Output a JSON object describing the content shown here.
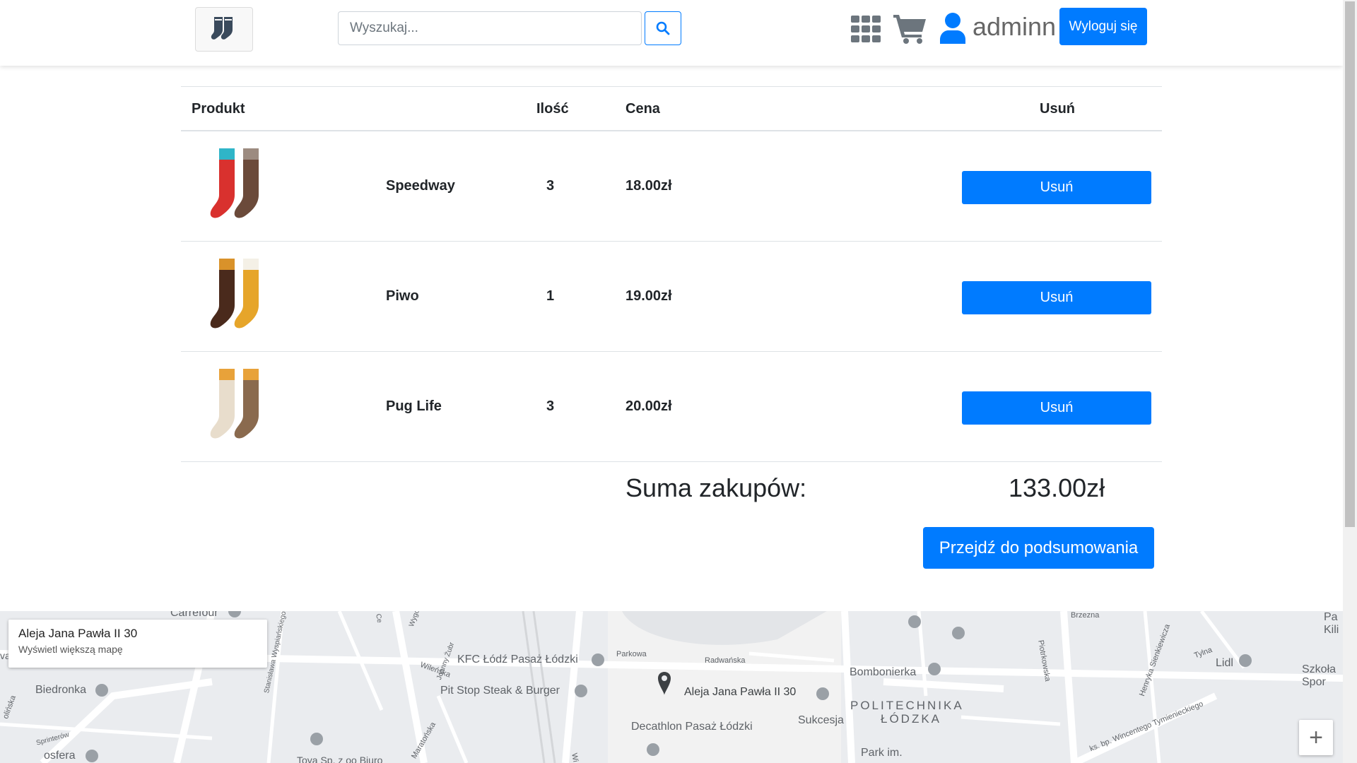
{
  "header": {
    "logo_icon": "socks-logo-icon",
    "search_placeholder": "Wyszukaj...",
    "search_icon": "search-icon",
    "grid_icon": "grid-icon",
    "cart_icon": "cart-icon",
    "user_icon": "user-icon",
    "username": "adminn",
    "logout_label": "Wyloguj się"
  },
  "cart": {
    "columns": {
      "product": "Produkt",
      "quantity": "Ilość",
      "price": "Cena",
      "remove": "Usuń"
    },
    "items": [
      {
        "name": "Speedway",
        "quantity": "3",
        "price": "18.00zł",
        "remove_label": "Usuń",
        "colors": {
          "left": "#d9312e",
          "right": "#6b4a3a",
          "cuff_left": "#2fb5c8",
          "cuff_right": "#9c8b80"
        }
      },
      {
        "name": "Piwo",
        "quantity": "1",
        "price": "19.00zł",
        "remove_label": "Usuń",
        "colors": {
          "left": "#4a2a1c",
          "right": "#e6a52a",
          "cuff_left": "#d9922a",
          "cuff_right": "#f4f0e6"
        }
      },
      {
        "name": "Pug Life",
        "quantity": "3",
        "price": "20.00zł",
        "remove_label": "Usuń",
        "colors": {
          "left": "#e8ddcc",
          "right": "#8a6a4e",
          "cuff_left": "#e8a23a",
          "cuff_right": "#e8a23a"
        }
      }
    ],
    "total_label": "Suma zakupów:",
    "total_value": "133.00zł",
    "checkout_label": "Przejdź do podsumowania"
  },
  "map": {
    "card_address": "Aleja Jana Pawła II 30",
    "card_link": "Wyświetl większą mapę",
    "pin_label": "Aleja Jana Pawła II 30",
    "labels": {
      "biedronka": "Biedronka",
      "kfc": "KFC Łódź Pasaż Łódzki",
      "pitstop": "Pit Stop Steak & Burger",
      "decathlon": "Decathlon Pasaż Łódzki",
      "bombonierka": "Bombonierka",
      "sukcesja": "Sukcesja",
      "lidl": "Lidl",
      "szkola": "Szkoła Spor",
      "politechnika_1": "POLITECHNIKA",
      "politechnika_2": "ŁÓDZKA",
      "park": "Park im.",
      "osfera": "osfera",
      "carrefour": "Carrefour",
      "kili": "Pa Kili",
      "toya": "Toya Sp. z oo Biuro",
      "radwanska": "Radwańska",
      "parkowa": "Parkowa",
      "piotrkowska": "Piotrkowska",
      "wincentego": "ks. bp. Wincentego Tymienieckiego",
      "sienkiewicza": "Henryka Sienkiewicza",
      "tylna": "Tylna",
      "brzezna": "Brzezna",
      "wilenska": "Wileńska",
      "maratonska": "Maratońska",
      "wyspianskiego": "Stanisława Wyspiańskiego",
      "sprinterow": "Sprinterów",
      "zubrowej": "Joanny Żubr",
      "wygo": "Wygo",
      "ce": "Ce",
      "va": "va",
      "olinska": "olińska",
      "wi": "Wi"
    },
    "zoom_in": "+"
  }
}
